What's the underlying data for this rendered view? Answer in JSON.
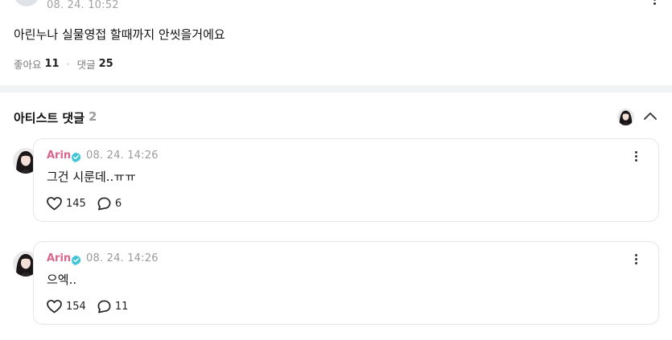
{
  "post": {
    "time": "08. 24. 10:52",
    "body": "아린누나 실물영접 할때까지 안씻을거에요",
    "likes_label": "좋아요",
    "likes_count": "11",
    "separator": "·",
    "replies_label": "댓글",
    "replies_count": "25"
  },
  "artist_section": {
    "title": "아티스트 댓글",
    "count": "2"
  },
  "comments": [
    {
      "author": "Arin",
      "time": "08. 24. 14:26",
      "text": "그건 시룬데..ㅠㅠ",
      "likes": "145",
      "replies": "6"
    },
    {
      "author": "Arin",
      "time": "08. 24. 14:26",
      "text": "으엑..",
      "likes": "154",
      "replies": "11"
    }
  ],
  "colors": {
    "author_name": "#d9668f",
    "verified_badge": "#3cc4d6",
    "divider": "#f2f3f5",
    "card_border": "#e6e6e6"
  },
  "icons": {
    "like": "heart-icon",
    "reply": "speech-bubble-icon",
    "more": "more-vertical-icon",
    "verified": "verified-check-icon",
    "collapse": "chevron-up-icon"
  }
}
